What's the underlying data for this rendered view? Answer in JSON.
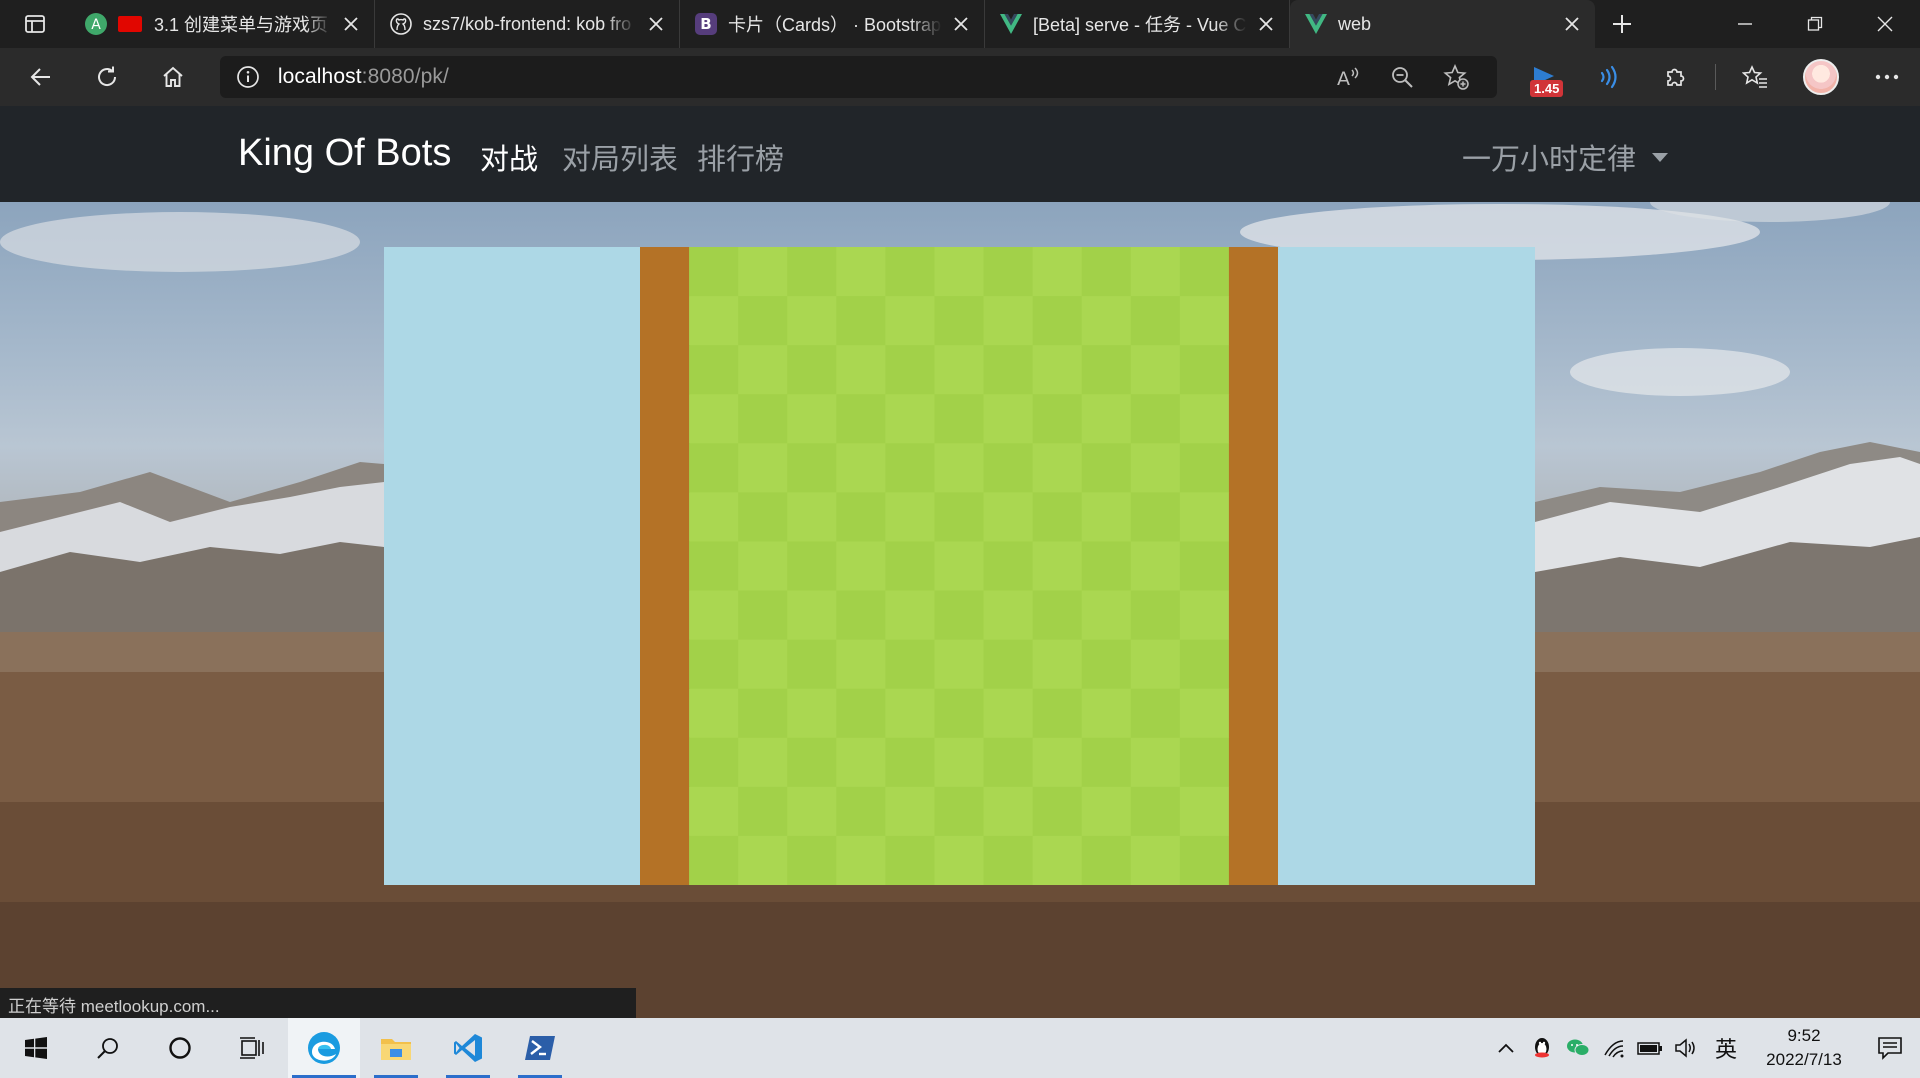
{
  "browser": {
    "tabs": [
      {
        "title": "3.1 创建菜单与游戏页",
        "favicon": "acwing-icon",
        "active": false
      },
      {
        "title": "szs7/kob-frontend: kob fro",
        "favicon": "github-icon",
        "active": false
      },
      {
        "title": "卡片（Cards） · Bootstrap",
        "favicon": "bootstrap-icon",
        "active": false
      },
      {
        "title": "[Beta] serve - 任务 - Vue C",
        "favicon": "vue-icon",
        "active": false
      },
      {
        "title": "web",
        "favicon": "vue-icon",
        "active": true
      }
    ],
    "address": {
      "host": "localhost",
      "rest": ":8080/pk/"
    },
    "extension_badge": "1.45",
    "status_text": "正在等待 meetlookup.com..."
  },
  "app": {
    "brand": "King Of Bots",
    "nav": [
      {
        "label": "对战",
        "active": true
      },
      {
        "label": "对局列表",
        "active": false
      },
      {
        "label": "排行榜",
        "active": false
      }
    ],
    "user_menu": "一万小时定律"
  },
  "game": {
    "rows": 13,
    "cols": 13,
    "wall_columns": [
      0,
      12
    ],
    "colors": {
      "background": "#ADD8E6",
      "wall": "#B47226",
      "grass_light": "#AAD751",
      "grass_dark": "#A2D149"
    }
  },
  "taskbar": {
    "apps": [
      "windows-start-icon",
      "search-icon",
      "cortana-icon",
      "task-view-icon",
      "edge-icon",
      "file-explorer-icon",
      "vscode-icon",
      "powershell-icon"
    ],
    "ime": "英",
    "time": "9:52",
    "date": "2022/7/13"
  }
}
